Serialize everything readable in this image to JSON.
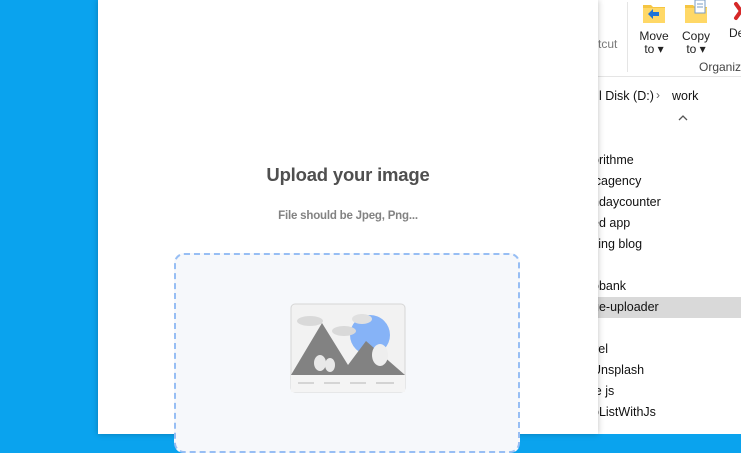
{
  "explorer": {
    "ribbon": {
      "shortcut_fragment": "tcut",
      "move_to": {
        "line1": "Move",
        "line2": "to ▾"
      },
      "copy_to": {
        "line1": "Copy",
        "line2": "to ▾"
      },
      "delete_fragment": "De",
      "group_label": "Organiz"
    },
    "address": {
      "segment_1": "l Disk (D:)",
      "segment_2": "work"
    },
    "files": [
      {
        "name": "orithme"
      },
      {
        "name": "icagency"
      },
      {
        "name": "hdaycounter"
      },
      {
        "name": "ed app"
      },
      {
        "name": "king blog"
      },
      {
        "name": ""
      },
      {
        "name": "obank"
      },
      {
        "name": "ge-uploader",
        "selected": true
      },
      {
        "name": ""
      },
      {
        "name": "vel"
      },
      {
        "name": "Unsplash"
      },
      {
        "name": "le js"
      },
      {
        "name": "oListWithJs"
      }
    ]
  },
  "upload": {
    "title": "Upload your image",
    "subtitle": "File should be Jpeg, Png..."
  },
  "colors": {
    "desktop": "#0aa3ee",
    "dropzone_border": "#97bef4",
    "dropzone_bg": "#f6f8fb",
    "selected_row": "#d9d9d9",
    "illustration_sun": "#86b3f7",
    "illustration_mountain": "#828282"
  },
  "icons": [
    "folder-move-icon",
    "folder-copy-icon",
    "delete-icon",
    "chevron-right-icon",
    "sort-up-icon",
    "image-placeholder-icon"
  ]
}
